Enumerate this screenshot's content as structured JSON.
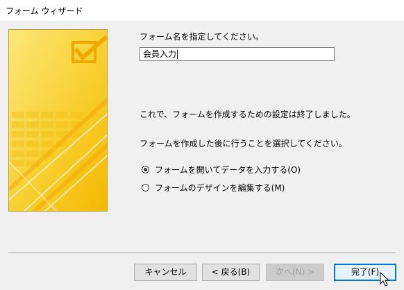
{
  "window": {
    "title": "フォーム ウィザード"
  },
  "form": {
    "name_label": "フォーム名を指定してください。",
    "name_value": "会員入力"
  },
  "info": {
    "done_text": "これで、フォームを作成するための設定は終了しました。",
    "next_action_text": "フォームを作成した後に行うことを選択してください。"
  },
  "options": [
    {
      "label": "フォームを開いてデータを入力する(O)",
      "checked": true
    },
    {
      "label": "フォームのデザインを編集する(M)",
      "checked": false
    }
  ],
  "buttons": {
    "cancel": "キャンセル",
    "back": "< 戻る(B)",
    "next": "次へ(N) >",
    "finish": "完了(F)"
  },
  "colors": {
    "accent": "#0078d7",
    "illustration": "#f7cf2f"
  }
}
